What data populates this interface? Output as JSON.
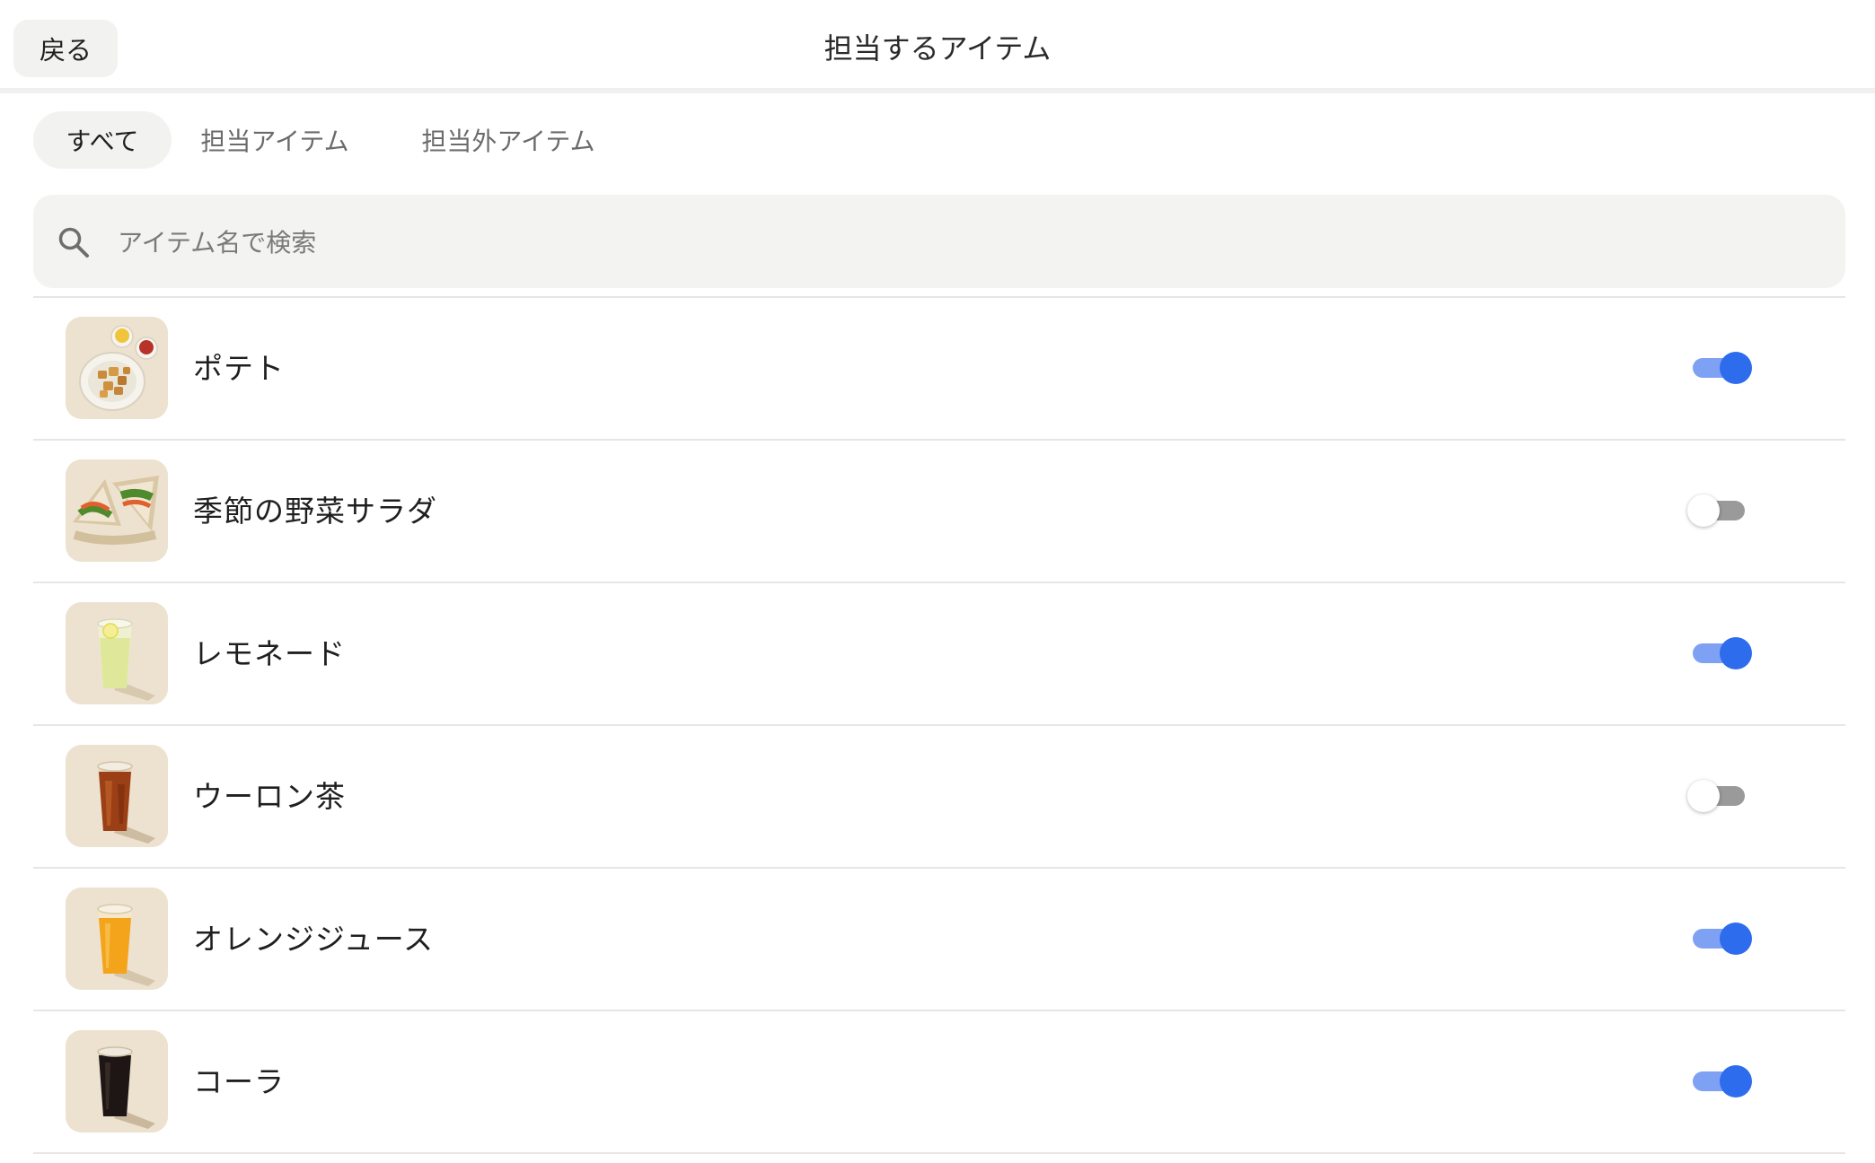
{
  "header": {
    "back_label": "戻る",
    "title": "担当するアイテム"
  },
  "tabs": [
    {
      "label": "すべて",
      "active": true
    },
    {
      "label": "担当アイテム",
      "active": false
    },
    {
      "label": "担当外アイテム",
      "active": false
    }
  ],
  "search": {
    "placeholder": "アイテム名で検索",
    "value": "",
    "icon": "search-icon"
  },
  "items": [
    {
      "name": "ポテト",
      "enabled": true,
      "image": "fries-plate-image"
    },
    {
      "name": "季節の野菜サラダ",
      "enabled": false,
      "image": "sandwich-image"
    },
    {
      "name": "レモネード",
      "enabled": true,
      "image": "lemonade-cup-image"
    },
    {
      "name": "ウーロン茶",
      "enabled": false,
      "image": "oolong-tea-cup-image"
    },
    {
      "name": "オレンジジュース",
      "enabled": true,
      "image": "orange-juice-cup-image"
    },
    {
      "name": "コーラ",
      "enabled": true,
      "image": "cola-cup-image"
    }
  ],
  "colors": {
    "toggle_on_knob": "#2d6ced",
    "toggle_on_track": "#7fa1f3",
    "toggle_off_track": "#9a9a9a",
    "thumb_background": "#ece2cf"
  }
}
